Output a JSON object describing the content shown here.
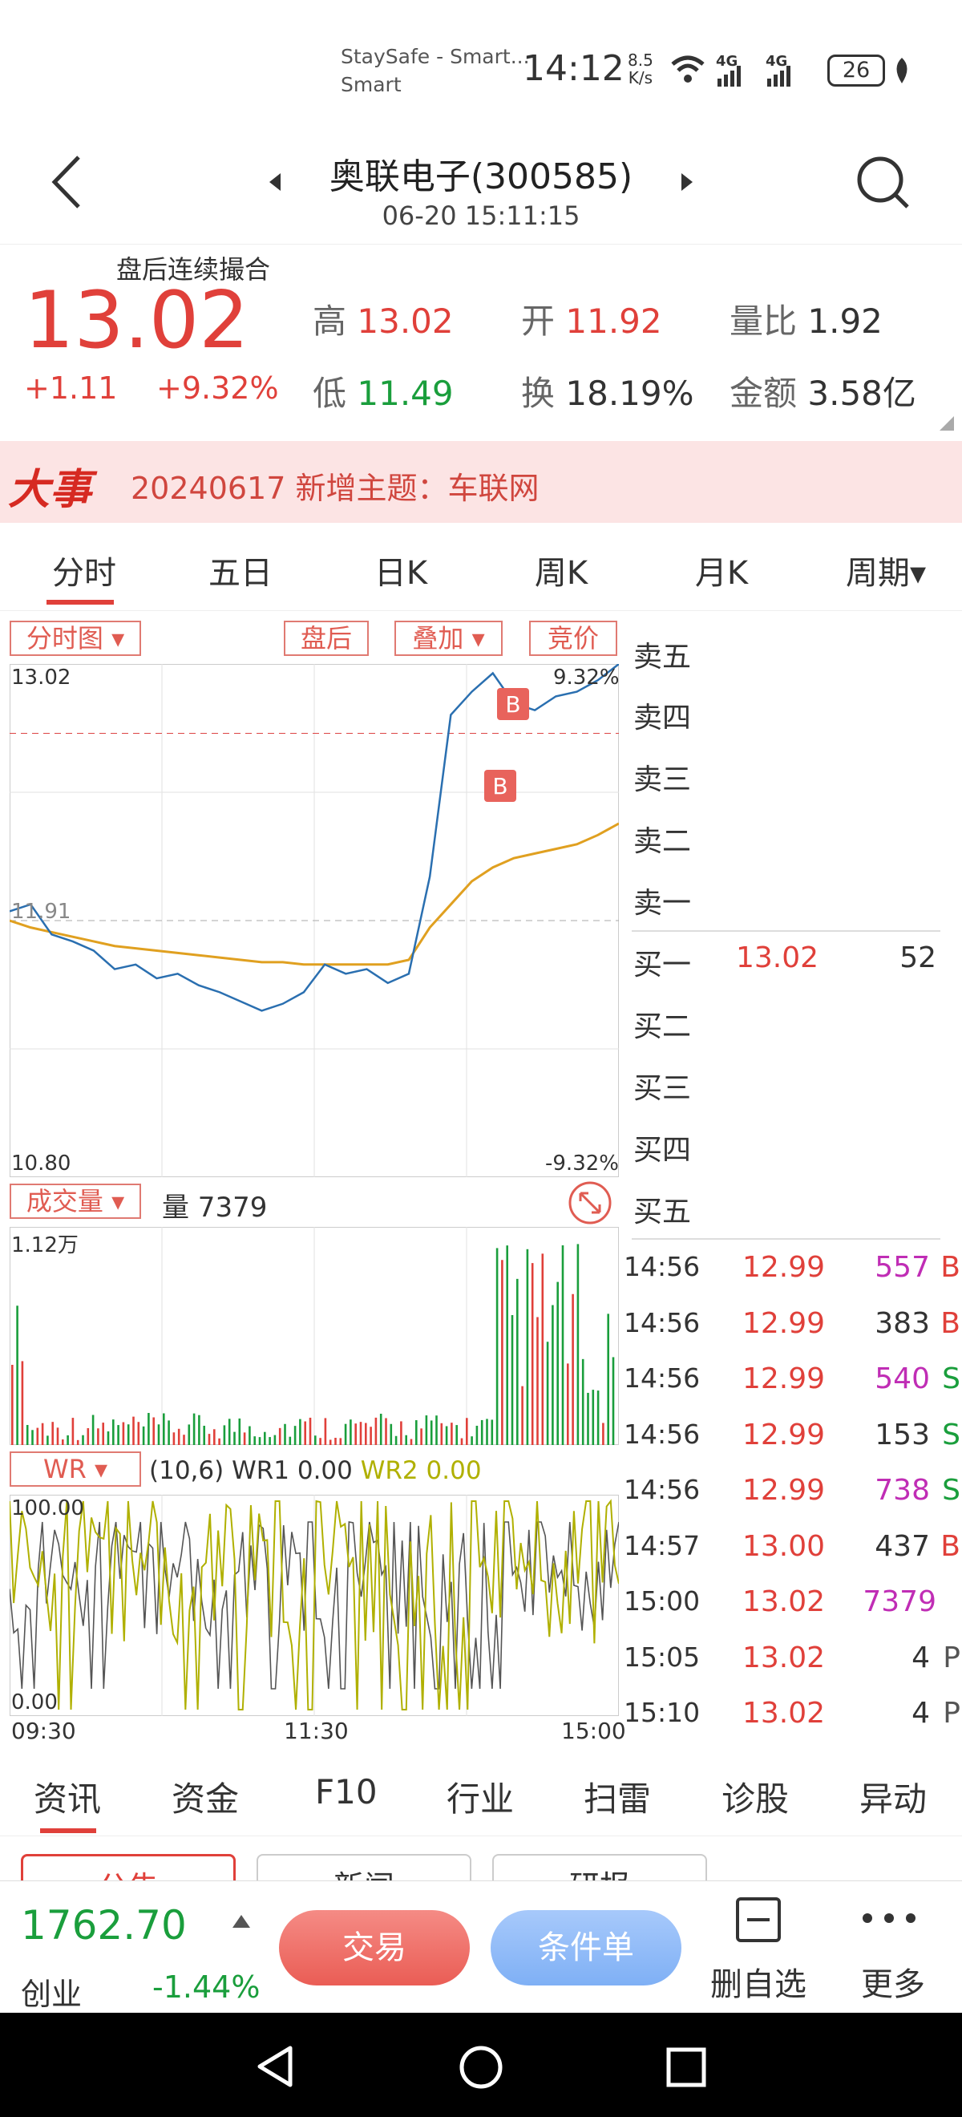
{
  "status": {
    "notif_title": "StaySafe - Smart...",
    "notif_sub": "Smart",
    "time": "14:12",
    "speed_top": "8.5",
    "speed_bottom": "K/s",
    "net1": "4G",
    "net2": "4G",
    "battery": "26"
  },
  "header": {
    "title": "奥联电子(300585)",
    "datetime": "06-20 15:11:15"
  },
  "quote": {
    "session": "盘后连续撮合",
    "price": "13.02",
    "change": "+1.11",
    "change_pct": "+9.32%",
    "high_label": "高",
    "high": "13.02",
    "open_label": "开",
    "open": "11.92",
    "vr_label": "量比",
    "vr": "1.92",
    "low_label": "低",
    "low": "11.49",
    "turn_label": "换",
    "turn": "18.19%",
    "amt_label": "金额",
    "amt": "3.58亿"
  },
  "banner": {
    "tag": "大事",
    "text": "20240617 新增主题：车联网"
  },
  "period_tabs": [
    "分时",
    "五日",
    "日K",
    "周K",
    "月K",
    "周期▾"
  ],
  "chart_toolbar": {
    "type": "分时图",
    "after": "盘后",
    "overlay": "叠加",
    "auction": "竞价"
  },
  "price_axis": {
    "top": "13.02",
    "top_pct": "9.32%",
    "mid": "11.91",
    "bottom": "10.80",
    "bottom_pct": "-9.32%"
  },
  "volume": {
    "indicator": "成交量",
    "label": "量 7379",
    "max": "1.12万"
  },
  "wr": {
    "indicator": "WR",
    "params": "(10,6) WR1",
    "wr1": "0.00",
    "wr2_label": "WR2",
    "wr2": "0.00",
    "top": "100.00",
    "bottom": "0.00"
  },
  "time_axis": [
    "09:30",
    "11:30",
    "15:00"
  ],
  "order_book": [
    {
      "label": "卖五",
      "price": "",
      "vol": ""
    },
    {
      "label": "卖四",
      "price": "",
      "vol": ""
    },
    {
      "label": "卖三",
      "price": "",
      "vol": ""
    },
    {
      "label": "卖二",
      "price": "",
      "vol": ""
    },
    {
      "label": "卖一",
      "price": "",
      "vol": ""
    },
    {
      "label": "买一",
      "price": "13.02",
      "vol": "52"
    },
    {
      "label": "买二",
      "price": "",
      "vol": ""
    },
    {
      "label": "买三",
      "price": "",
      "vol": ""
    },
    {
      "label": "买四",
      "price": "",
      "vol": ""
    },
    {
      "label": "买五",
      "price": "",
      "vol": ""
    }
  ],
  "trades": [
    {
      "time": "14:56",
      "price": "12.99",
      "vol": "557",
      "side": "B",
      "color": "#c02db5"
    },
    {
      "time": "14:56",
      "price": "12.99",
      "vol": "383",
      "side": "B",
      "color": "#333333"
    },
    {
      "time": "14:56",
      "price": "12.99",
      "vol": "540",
      "side": "S",
      "color": "#c02db5"
    },
    {
      "time": "14:56",
      "price": "12.99",
      "vol": "153",
      "side": "S",
      "color": "#333333"
    },
    {
      "time": "14:56",
      "price": "12.99",
      "vol": "738",
      "side": "S",
      "color": "#c02db5"
    },
    {
      "time": "14:57",
      "price": "13.00",
      "vol": "437",
      "side": "B",
      "color": "#333333"
    },
    {
      "time": "15:00",
      "price": "13.02",
      "vol": "7379",
      "side": "",
      "color": "#c02db5"
    },
    {
      "time": "15:05",
      "price": "13.02",
      "vol": "4",
      "side": "P",
      "color": "#333333"
    },
    {
      "time": "15:10",
      "price": "13.02",
      "vol": "4",
      "side": "P",
      "color": "#333333"
    }
  ],
  "bottom_tabs": [
    "资讯",
    "资金",
    "F10",
    "行业",
    "扫雷",
    "诊股",
    "异动"
  ],
  "sub_tabs": [
    "公告",
    "新闻",
    "研报"
  ],
  "dock": {
    "index_value": "1762.70",
    "index_name": "创业",
    "index_pct": "-1.44%",
    "trade_btn": "交易",
    "cond_btn": "条件单",
    "remove_label": "删自选",
    "more_label": "更多"
  },
  "colors": {
    "up": "#e0403a",
    "down": "#1a9e3c",
    "price_line": "#2a6fb0",
    "avg_line": "#e0a020",
    "wr1": "#555555",
    "wr2": "#b0b000"
  },
  "chart_data": {
    "type": "line",
    "title": "",
    "x": [
      "09:30",
      "11:30",
      "15:00"
    ],
    "ylim": [
      10.8,
      13.02
    ],
    "reference": 11.91,
    "series": [
      {
        "values": [
          11.95,
          11.98,
          11.85,
          11.82,
          11.78,
          11.7,
          11.72,
          11.66,
          11.68,
          11.63,
          11.6,
          11.56,
          11.52,
          11.55,
          11.6,
          11.72,
          11.68,
          11.7,
          11.64,
          11.68,
          12.1,
          12.8,
          12.9,
          12.98,
          12.85,
          12.82,
          12.88,
          12.9,
          12.95,
          13.02
        ]
      },
      {
        "values": [
          11.91,
          11.88,
          11.86,
          11.84,
          11.82,
          11.8,
          11.79,
          11.78,
          11.77,
          11.76,
          11.75,
          11.74,
          11.73,
          11.73,
          11.72,
          11.72,
          11.72,
          11.72,
          11.72,
          11.74,
          11.88,
          11.98,
          12.08,
          12.14,
          12.18,
          12.2,
          12.22,
          12.24,
          12.28,
          12.33
        ]
      }
    ],
    "volume_max": 11200,
    "wr_range": [
      0,
      100
    ]
  }
}
